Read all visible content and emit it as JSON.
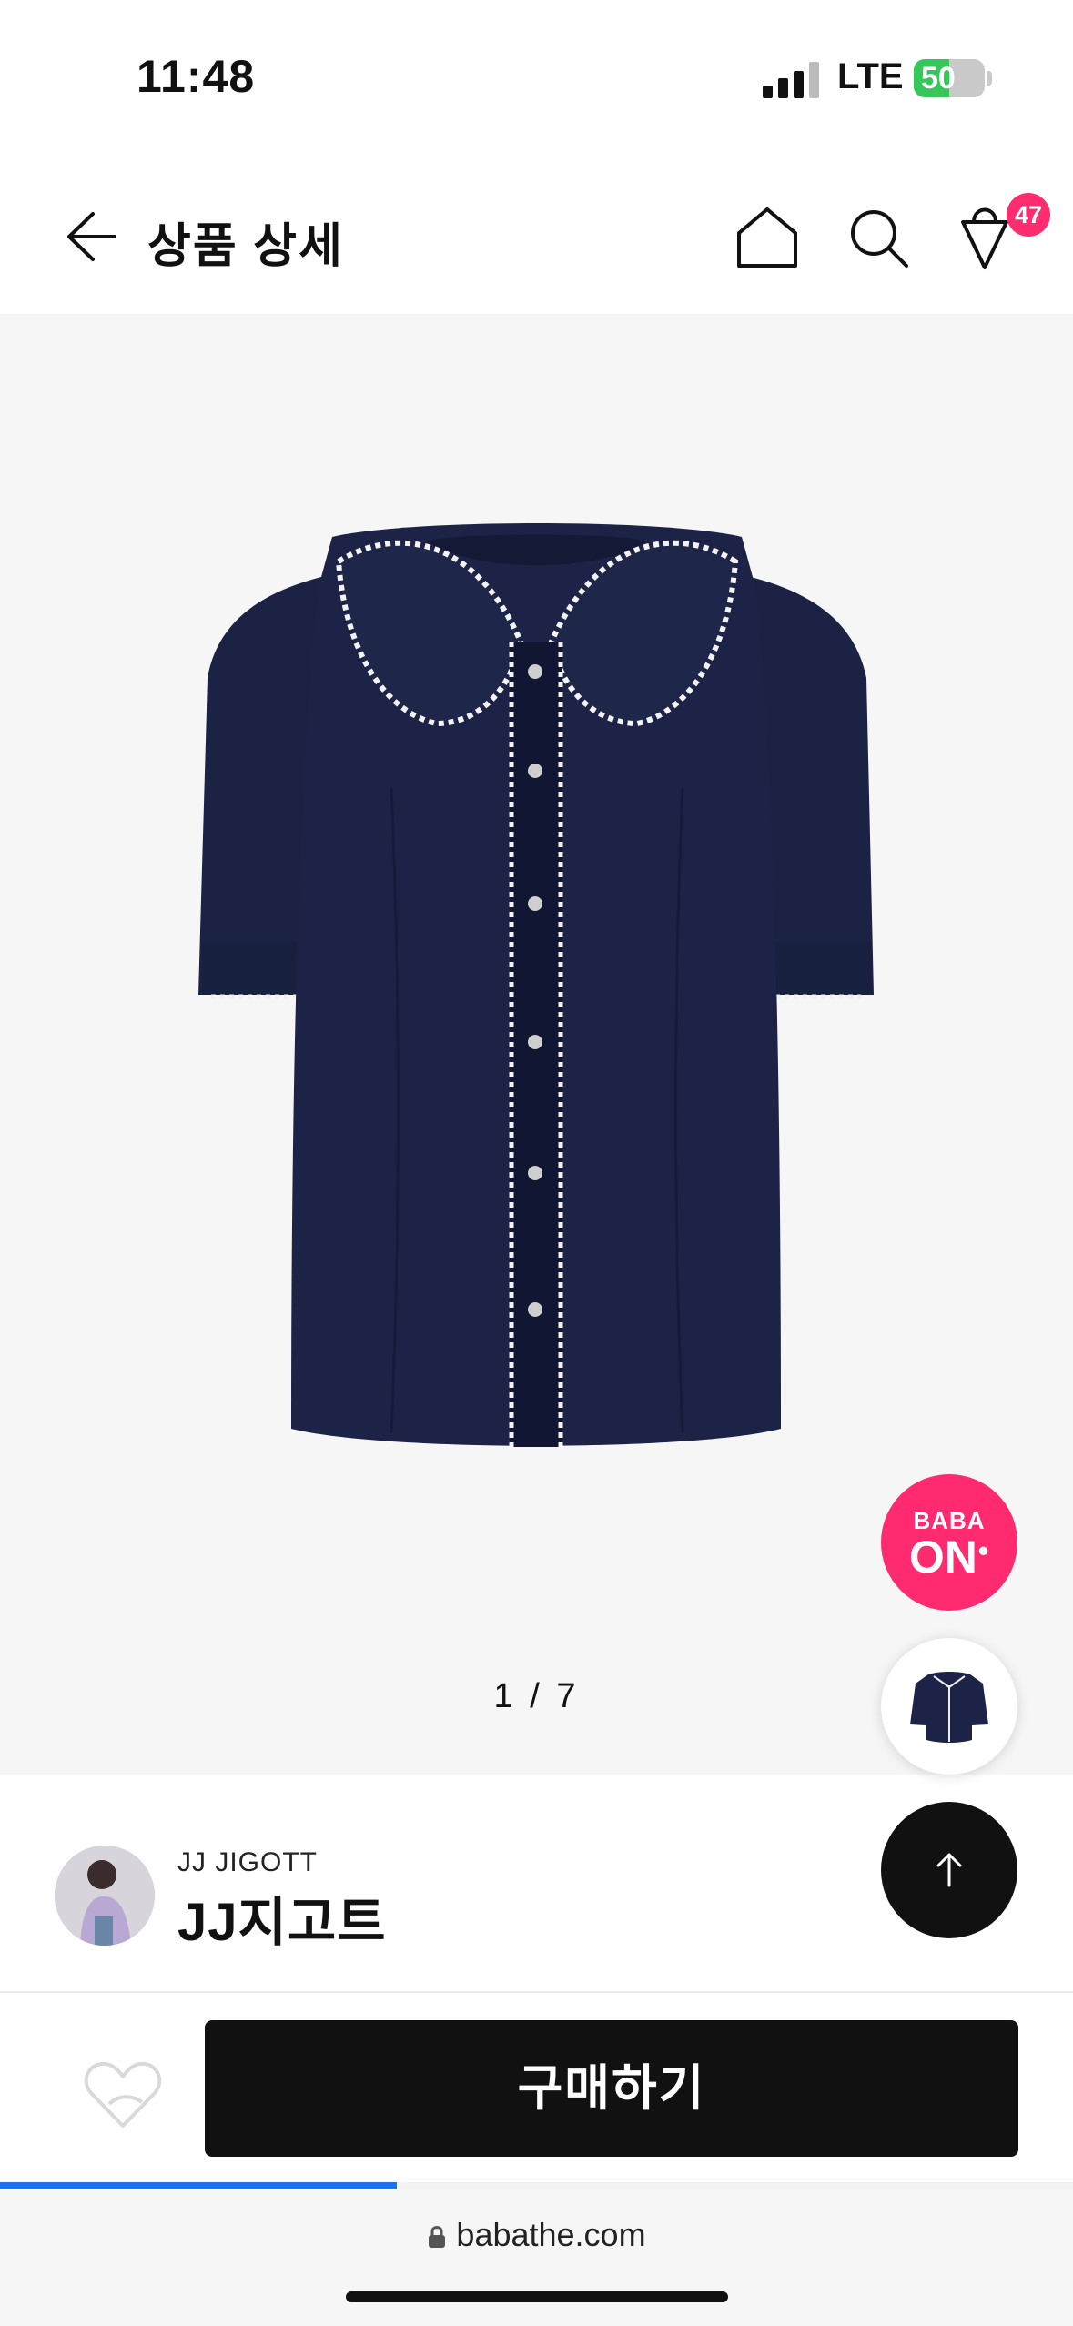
{
  "status_bar": {
    "time": "11:48",
    "network": "LTE",
    "battery_percent": 50,
    "battery_label": "50"
  },
  "header": {
    "title": "상품 상세",
    "cart_count": "47",
    "icons": [
      "back-arrow-icon",
      "home-icon",
      "search-icon",
      "cart-icon"
    ]
  },
  "gallery": {
    "counter": "1 / 7",
    "current": 1,
    "total": 7
  },
  "floating": {
    "baba_line1": "BABA",
    "baba_line2": "ON",
    "accent_color": "#ff2a6f"
  },
  "brand": {
    "name_en": "JJ JIGOTT",
    "name_ko": "JJ지고트"
  },
  "action_bar": {
    "buy_label": "구매하기"
  },
  "browser": {
    "url": "babathe.com",
    "load_progress": 0.37
  }
}
